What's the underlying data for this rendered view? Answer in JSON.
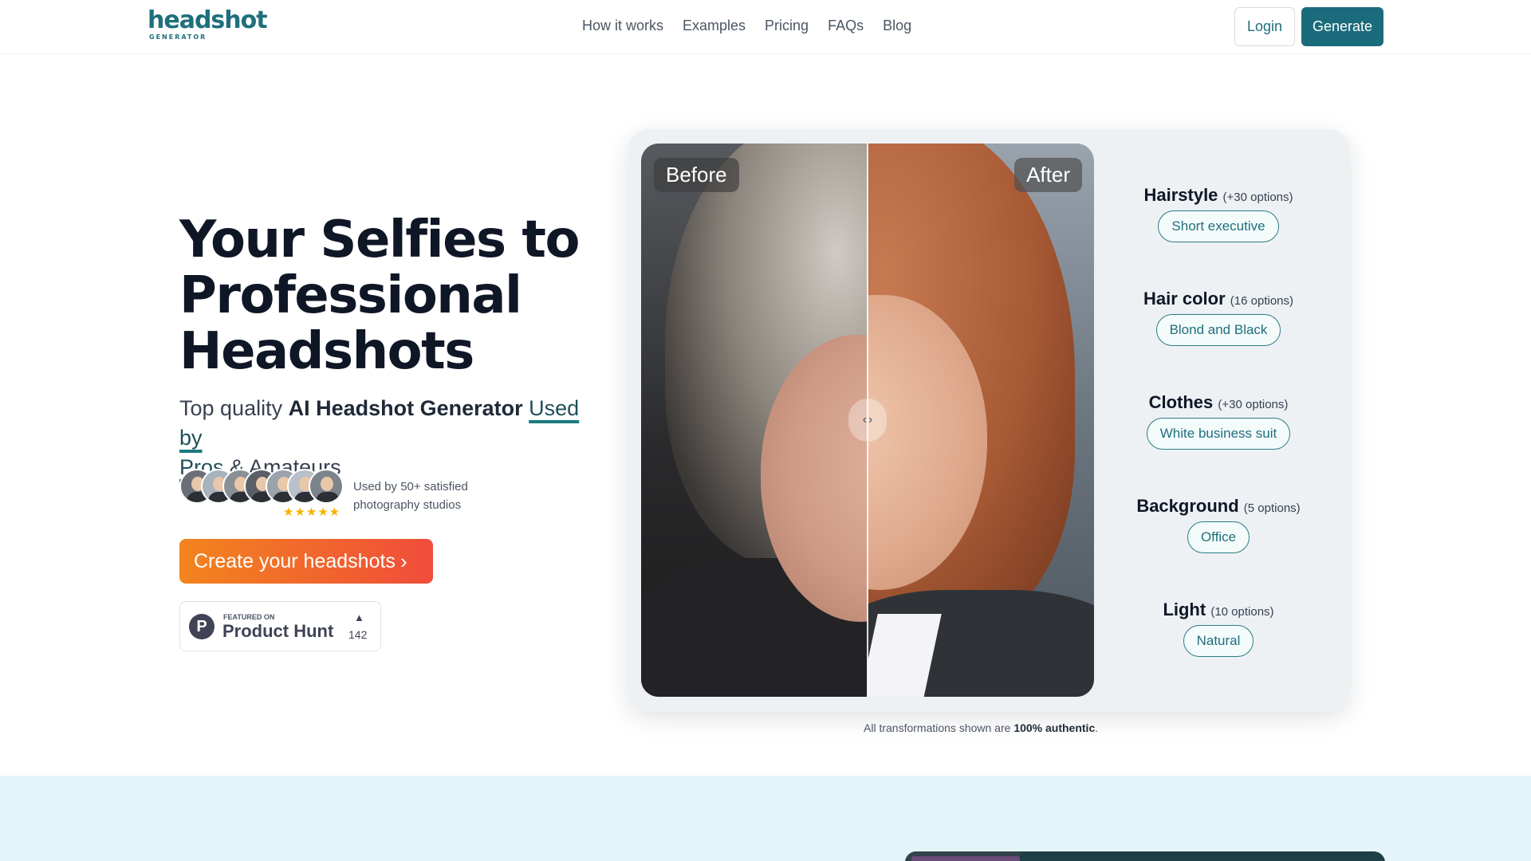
{
  "brand": {
    "name": "headshot",
    "tagline": "GENERATOR"
  },
  "nav": {
    "items": [
      {
        "label": "How it works"
      },
      {
        "label": "Examples"
      },
      {
        "label": "Pricing"
      },
      {
        "label": "FAQs"
      },
      {
        "label": "Blog"
      }
    ],
    "login_label": "Login",
    "generate_label": "Generate"
  },
  "hero": {
    "title_lines": [
      "Your Selfies to",
      "Professional",
      "Headshots"
    ],
    "subtitle_pre": "Top quality ",
    "subtitle_strong": "AI Headshot Generator",
    "subtitle_underlined_1": "Used by",
    "subtitle_underlined_2": "Pros",
    "subtitle_post": " & Amateurs",
    "social_proof_text": "Used by 50+ satisfied photography studios",
    "rating_stars": 5,
    "stars_glyph": "★★★★★",
    "cta_label": "Create your headshots",
    "cta_chevron": "›",
    "avatar_count": 7
  },
  "product_hunt": {
    "featured_text": "FEATURED ON",
    "name": "Product Hunt",
    "logo_letter": "P",
    "arrow": "▲",
    "upvotes": "142"
  },
  "comparison": {
    "before_label": "Before",
    "after_label": "After",
    "handle_left": "‹",
    "handle_right": "›"
  },
  "options": [
    {
      "title": "Hairstyle",
      "count": "(+30 options)",
      "value": "Short executive"
    },
    {
      "title": "Hair color",
      "count": "(16 options)",
      "value": "Blond and Black"
    },
    {
      "title": "Clothes",
      "count": "(+30 options)",
      "value": "White business suit"
    },
    {
      "title": "Background",
      "count": "(5 options)",
      "value": "Office"
    },
    {
      "title": "Light",
      "count": "(10 options)",
      "value": "Natural"
    }
  ],
  "caption": {
    "pre": "All transformations shown are ",
    "strong": "100% authentic",
    "post": "."
  },
  "colors": {
    "brand": "#1f6f7d",
    "cta_start": "#f2841e",
    "cta_end": "#f04d3a",
    "band": "#e4f5f9",
    "star": "#f5b301"
  }
}
